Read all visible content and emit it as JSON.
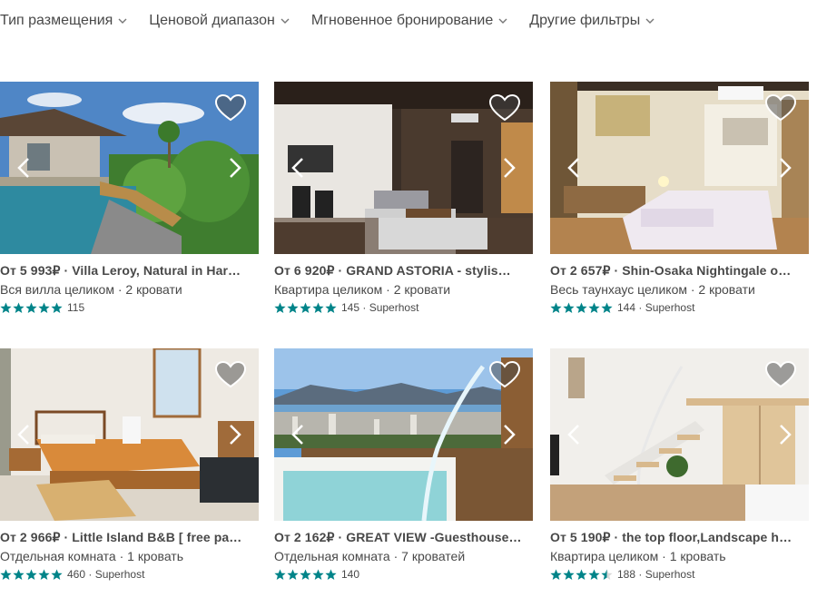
{
  "filters": [
    {
      "label": "Тип размещения"
    },
    {
      "label": "Ценовой диапазон"
    },
    {
      "label": "Мгновенное бронирование"
    },
    {
      "label": "Другие фильтры"
    }
  ],
  "colors": {
    "star": "#008489",
    "text": "#484848"
  },
  "listings": [
    {
      "price": "От 5 993₽",
      "name": "Villa Leroy, Natural in Har…",
      "type": "Вся вилла целиком · 2 кровати",
      "stars": 5,
      "reviews": "115",
      "badge": ""
    },
    {
      "price": "От 6 920₽",
      "name": "GRAND ASTORIA - stylis…",
      "type": "Квартира целиком · 2 кровати",
      "stars": 5,
      "reviews": "145",
      "badge": "· Superhost"
    },
    {
      "price": "От 2 657₽",
      "name": "Shin-Osaka Nightingale o…",
      "type": "Весь таунхаус целиком · 2 кровати",
      "stars": 5,
      "reviews": "144",
      "badge": "· Superhost"
    },
    {
      "price": "От 2 966₽",
      "name": "Little Island B&B [ free pa…",
      "type": "Отдельная комната · 1 кровать",
      "stars": 5,
      "reviews": "460",
      "badge": "· Superhost"
    },
    {
      "price": "От 2 162₽",
      "name": "GREAT VIEW -Guesthouse…",
      "type": "Отдельная комната · 7 кроватей",
      "stars": 5,
      "reviews": "140",
      "badge": ""
    },
    {
      "price": "От 5 190₽",
      "name": "the top floor,Landscape h…",
      "type": "Квартира целиком · 1 кровать",
      "stars": 4.5,
      "reviews": "188",
      "badge": "· Superhost"
    }
  ]
}
